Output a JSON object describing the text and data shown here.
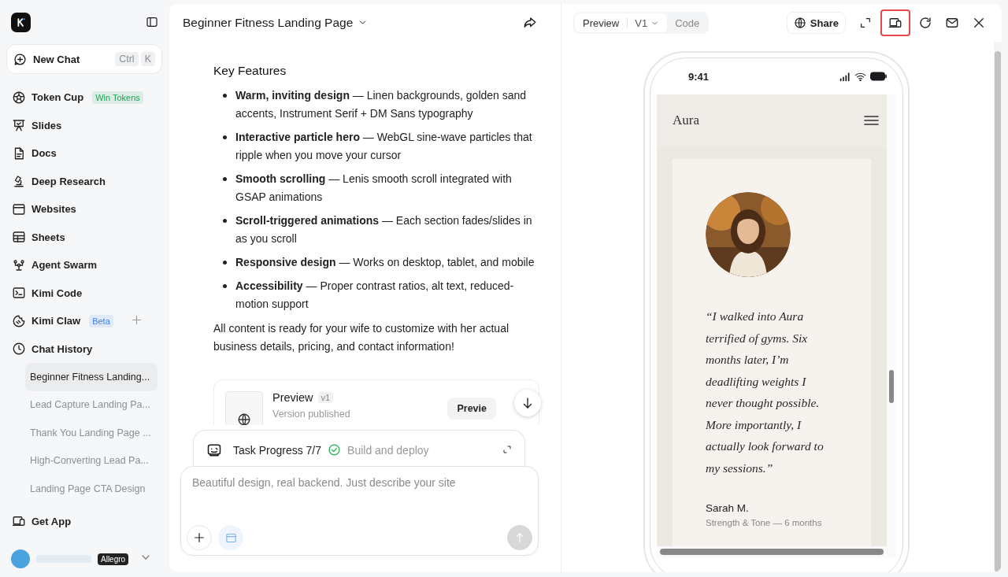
{
  "sidebar": {
    "new_chat": {
      "label": "New Chat",
      "keys": [
        "Ctrl",
        "K"
      ]
    },
    "nav": [
      {
        "kind": "cup",
        "label": "Token Cup",
        "badge": "Win Tokens",
        "color": "#1aa752"
      },
      {
        "kind": "slides",
        "label": "Slides"
      },
      {
        "kind": "doc",
        "label": "Docs"
      },
      {
        "kind": "research",
        "label": "Deep Research"
      },
      {
        "kind": "web",
        "label": "Websites"
      },
      {
        "kind": "sheet",
        "label": "Sheets"
      },
      {
        "kind": "swarm",
        "label": "Agent Swarm"
      },
      {
        "kind": "code",
        "label": "Kimi Code"
      },
      {
        "kind": "claw",
        "label": "Kimi Claw",
        "badge": "Beta",
        "color": "#3b82f6",
        "add": true
      },
      {
        "kind": "history",
        "label": "Chat History"
      }
    ],
    "history": [
      {
        "label": "Beginner Fitness Landing...",
        "selected": true
      },
      {
        "label": "Lead Capture Landing Pa...",
        "selected": false
      },
      {
        "label": "Thank You Landing Page ...",
        "selected": false
      },
      {
        "label": "High-Converting Lead Pa...",
        "selected": false
      },
      {
        "label": "Landing Page CTA Design",
        "selected": false
      }
    ],
    "get_app": "Get App",
    "user_badge": "Allegro"
  },
  "chat": {
    "title": "Beginner Fitness Landing Page",
    "heading": "Key Features",
    "features": [
      {
        "title": "Warm, inviting design",
        "text": " — Linen backgrounds, golden sand accents, Instrument Serif + DM Sans typography"
      },
      {
        "title": "Interactive particle hero",
        "text": " — WebGL sine-wave particles that ripple when you move your cursor"
      },
      {
        "title": "Smooth scrolling",
        "text": " — Lenis smooth scroll integrated with GSAP animations"
      },
      {
        "title": "Scroll-triggered animations",
        "text": " — Each section fades/slides in as you scroll"
      },
      {
        "title": "Responsive design",
        "text": " — Works on desktop, tablet, and mobile"
      },
      {
        "title": "Accessibility",
        "text": " — Proper contrast ratios, alt text, reduced-motion support"
      }
    ],
    "paragraph": "All content is ready for your wife to customize with her actual business details, pricing, and contact information!",
    "preview_card": {
      "title": "Preview",
      "version": "v1",
      "status": "Version published",
      "button": "Previe"
    },
    "task": {
      "label": "Task Progress 7/7",
      "step": "Build and deploy",
      "done": true
    },
    "input": {
      "placeholder": "Beautiful design, real backend. Just describe your site"
    }
  },
  "preview": {
    "tabs": [
      {
        "label": "Preview",
        "selected": true
      },
      {
        "label": "Code",
        "selected": false
      }
    ],
    "version": "V1",
    "share": "Share",
    "tools": [
      {
        "kind": "expand",
        "highlighted": false
      },
      {
        "kind": "device",
        "highlighted": true
      },
      {
        "kind": "refresh",
        "highlighted": false
      },
      {
        "kind": "mail",
        "highlighted": false
      },
      {
        "kind": "close",
        "highlighted": false
      }
    ],
    "phone": {
      "time": "9:41",
      "brand": "Aura",
      "quote": "“I walked into Aura terrified of gyms. Six months later, I’m deadlifting weights I never thought possible. More importantly, I actually look forward to my sessions.”",
      "name": "Sarah M.",
      "role": "Strength & Tone — 6 months"
    }
  }
}
